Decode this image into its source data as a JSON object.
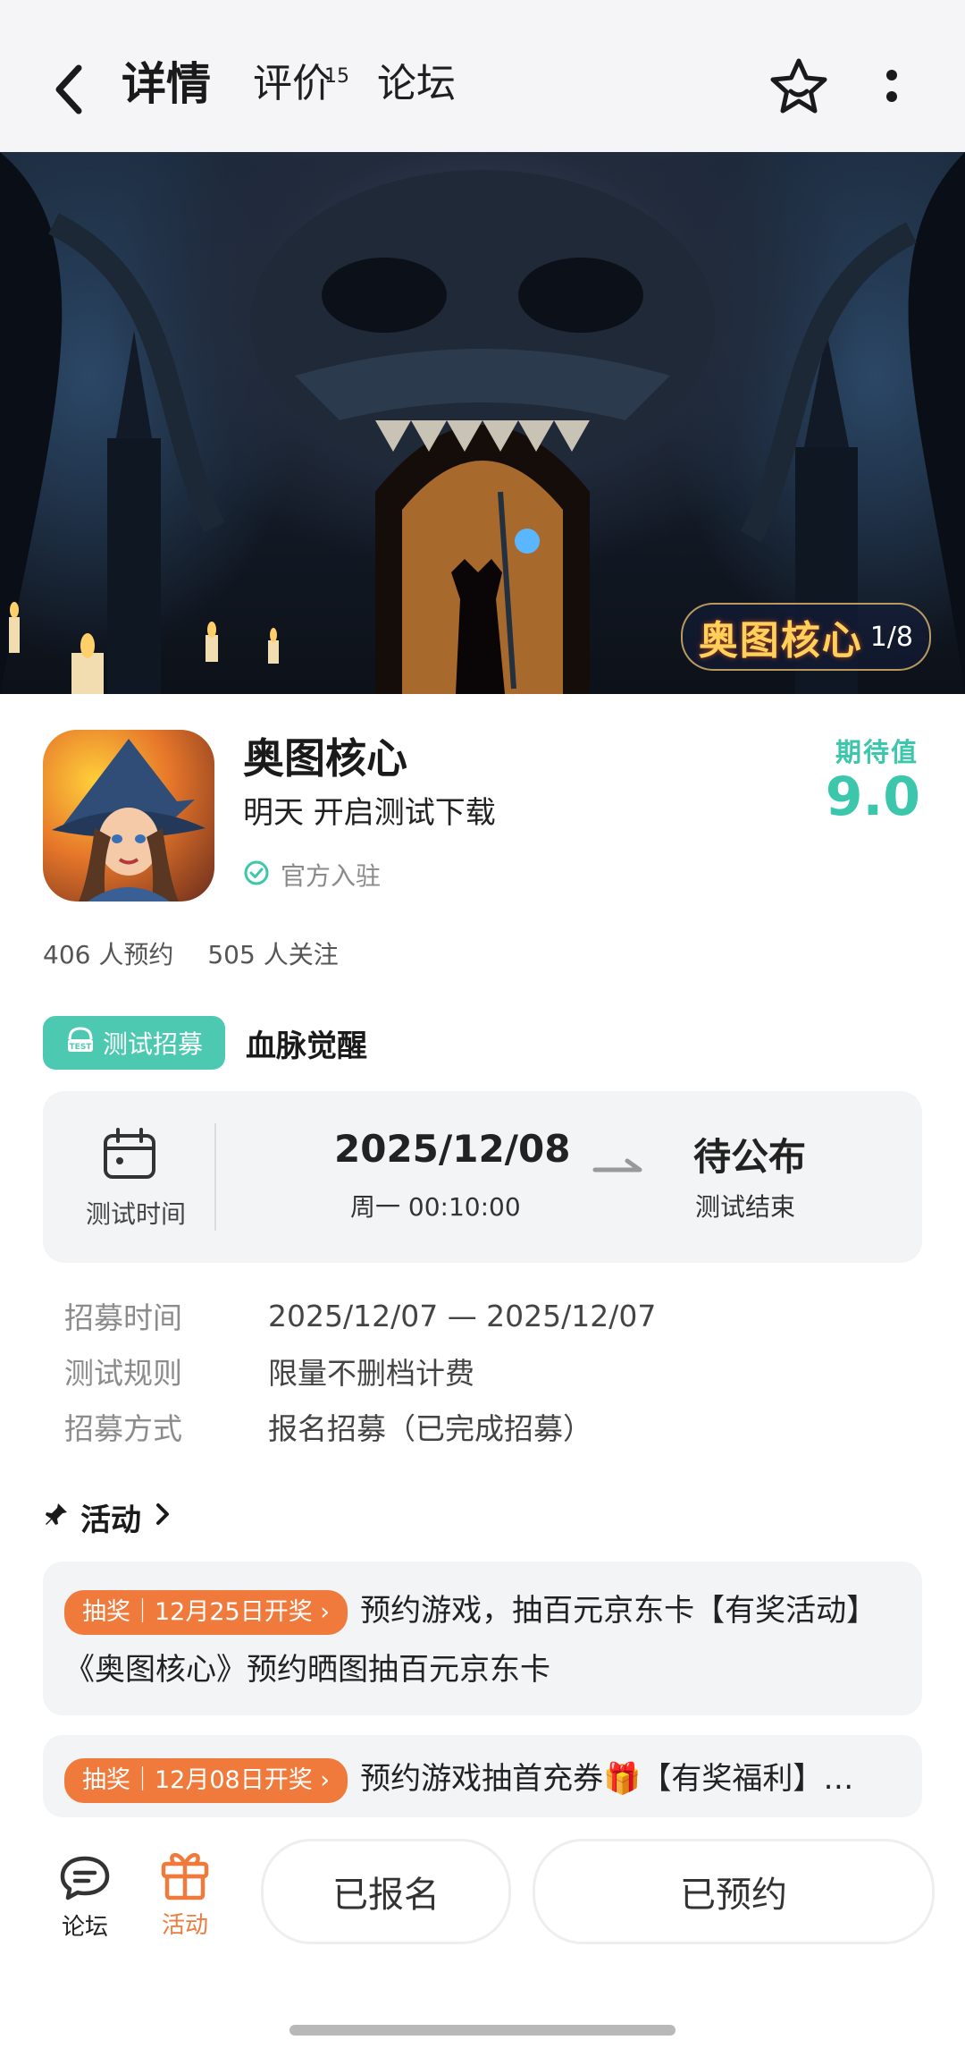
{
  "nav": {
    "tabs": [
      {
        "label": "详情",
        "active": true
      },
      {
        "label": "评价",
        "count": "15"
      },
      {
        "label": "论坛"
      }
    ]
  },
  "banner": {
    "logo_text": "奥图核心",
    "counter": "1/8"
  },
  "game": {
    "name": "奥图核心",
    "subtitle": "明天 开启测试下载",
    "official_label": "官方入驻",
    "expect_label": "期待值",
    "expect_score": "9.0",
    "reservations": "406 人预约",
    "followers": "505 人关注"
  },
  "recruit": {
    "tag_label": "测试招募",
    "title": "血脉觉醒",
    "time_label": "测试时间",
    "start_date": "2025/12/08",
    "start_detail": "周一  00:10:00",
    "end_value": "待公布",
    "end_label": "测试结束",
    "rows": [
      {
        "key": "招募时间",
        "value": "2025/12/07 — 2025/12/07"
      },
      {
        "key": "测试规则",
        "value": "限量不删档计费"
      },
      {
        "key": "招募方式",
        "value": "报名招募（已完成招募）"
      }
    ]
  },
  "activities": {
    "heading": "活动",
    "items": [
      {
        "pill": "抽奖｜12月25日开奖 ›",
        "text": "预约游戏，抽百元京东卡【有奖活动】《奥图核心》预约晒图抽百元京东卡"
      },
      {
        "pill": "抽奖｜12月08日开奖 ›",
        "text": "预约游戏抽首充券🎁【有奖福利】…"
      }
    ]
  },
  "bottom": {
    "forum_label": "论坛",
    "activity_label": "活动",
    "signup_label": "已报名",
    "reserve_label": "已预约"
  },
  "colors": {
    "accent_teal": "#3cc7ad",
    "accent_orange": "#f07a3c"
  },
  "icons": [
    "back-arrow-icon",
    "star-icon",
    "more-icon",
    "check-circle-icon",
    "test-badge-icon",
    "calendar-icon",
    "arrow-right-icon",
    "pin-icon",
    "chevron-right-icon",
    "forum-icon",
    "gift-icon"
  ]
}
